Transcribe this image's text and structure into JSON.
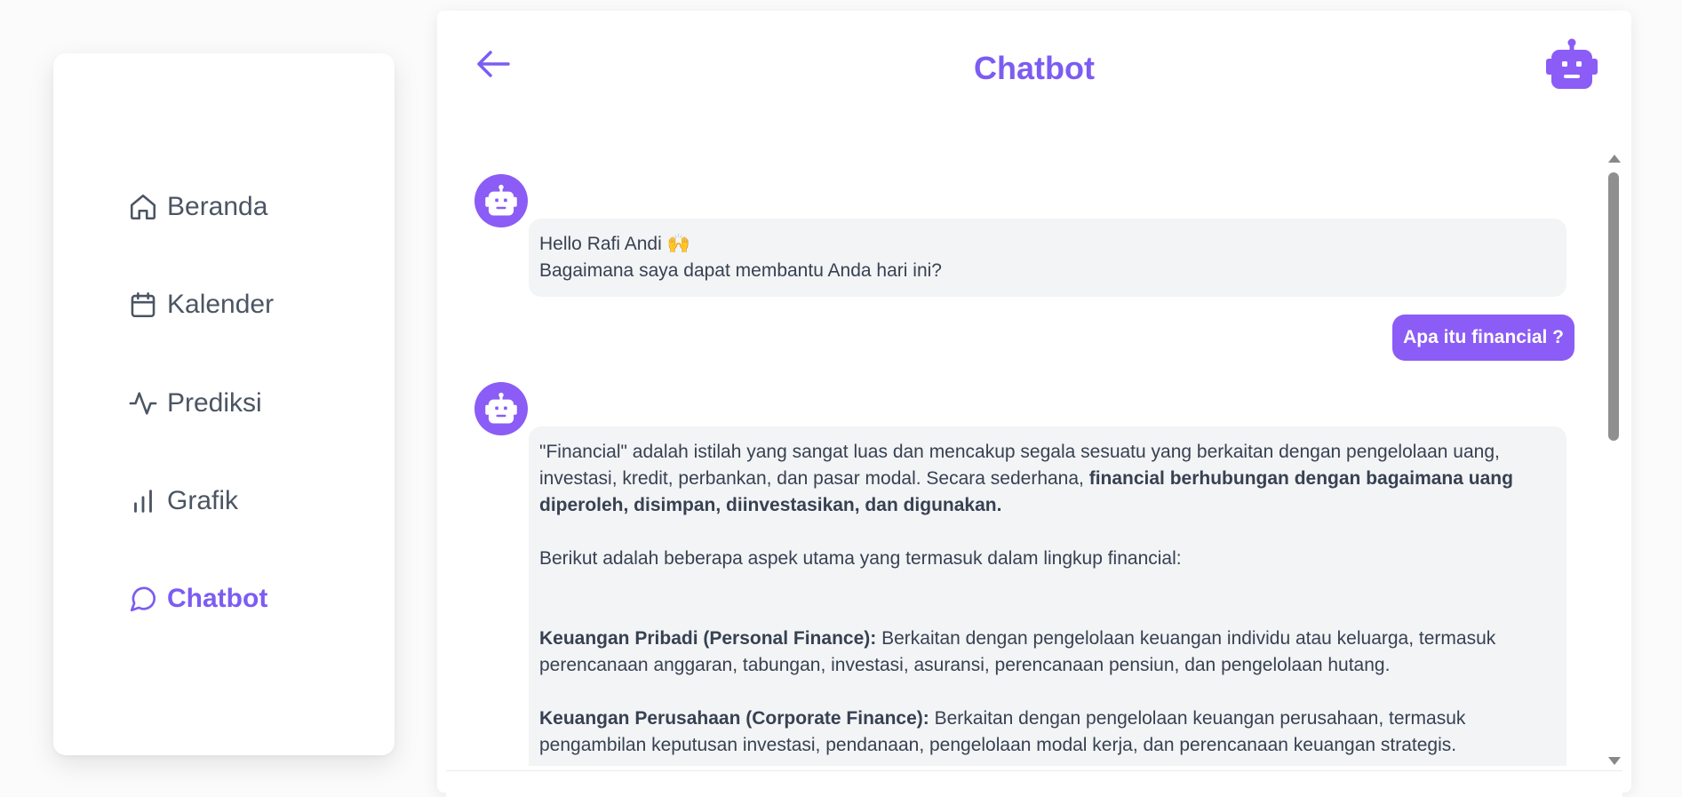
{
  "sidebar": {
    "items": [
      {
        "label": "Beranda",
        "icon": "home-icon",
        "active": false
      },
      {
        "label": "Kalender",
        "icon": "calendar-icon",
        "active": false
      },
      {
        "label": "Prediksi",
        "icon": "activity-icon",
        "active": false
      },
      {
        "label": "Grafik",
        "icon": "bar-chart-icon",
        "active": false
      },
      {
        "label": "Chatbot",
        "icon": "chat-bubble-icon",
        "active": true
      }
    ]
  },
  "header": {
    "title": "Chatbot",
    "back_icon": "arrow-left-icon",
    "bot_icon": "robot-icon"
  },
  "chat": {
    "messages": [
      {
        "role": "bot",
        "line1": "Hello Rafi Andi 🙌",
        "line2": "Bagaimana saya dapat membantu Anda hari ini?"
      },
      {
        "role": "user",
        "text": "Apa itu financial ?"
      },
      {
        "role": "bot",
        "p1_plain": "\"Financial\" adalah istilah yang sangat luas dan mencakup segala sesuatu yang berkaitan dengan pengelolaan uang, investasi, kredit, perbankan, dan pasar modal. Secara sederhana, ",
        "p1_bold": "financial berhubungan dengan bagaimana uang diperoleh, disimpan, diinvestasikan, dan digunakan.",
        "p2": "Berikut adalah beberapa aspek utama yang termasuk dalam lingkup financial:",
        "p3_bold": "Keuangan Pribadi (Personal Finance):",
        "p3_plain": " Berkaitan dengan pengelolaan keuangan individu atau keluarga, termasuk perencanaan anggaran, tabungan, investasi, asuransi, perencanaan pensiun, dan pengelolaan hutang.",
        "p4_bold": "Keuangan Perusahaan (Corporate Finance):",
        "p4_plain": " Berkaitan dengan pengelolaan keuangan perusahaan, termasuk pengambilan keputusan investasi, pendanaan, pengelolaan modal kerja, dan perencanaan keuangan strategis."
      }
    ]
  },
  "colors": {
    "accent": "#7c5cf2",
    "avatar_bg": "#8b5cf6",
    "bot_bubble": "#f3f4f6",
    "text": "#374151"
  }
}
